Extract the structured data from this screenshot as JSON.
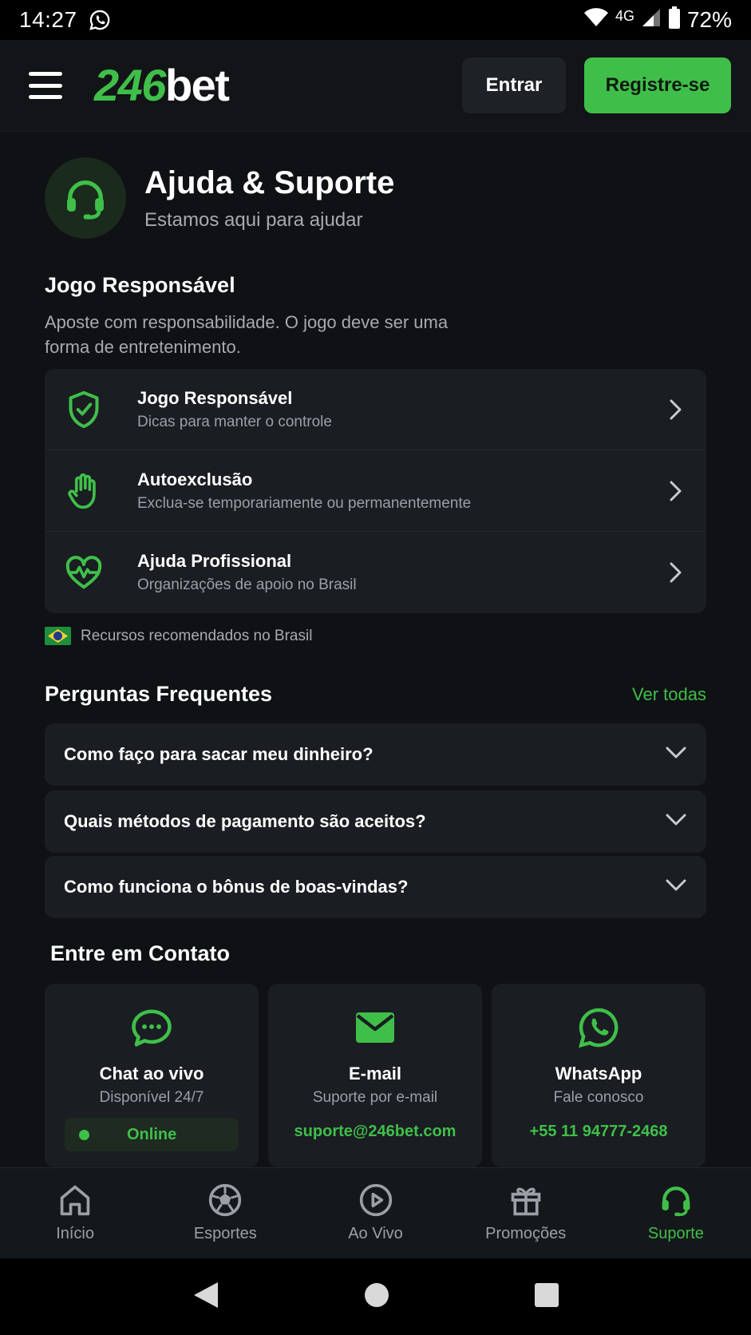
{
  "status_bar": {
    "time": "14:27",
    "network": "4G",
    "battery": "72%"
  },
  "header": {
    "logo_number": "246",
    "logo_text": "bet",
    "login_label": "Entrar",
    "register_label": "Registre-se"
  },
  "hero": {
    "title": "Ajuda & Suporte",
    "subtitle": "Estamos aqui para ajudar"
  },
  "responsible": {
    "title": "Jogo Responsável",
    "description": "Aposte com responsabilidade. O jogo deve ser uma forma de entretenimento.",
    "items": [
      {
        "title": "Jogo Responsável",
        "subtitle": "Dicas para manter o controle",
        "icon": "shield-check-icon"
      },
      {
        "title": "Autoexclusão",
        "subtitle": "Exclua-se temporariamente ou permanentemente",
        "icon": "hand-stop-icon"
      },
      {
        "title": "Ajuda Profissional",
        "subtitle": "Organizações de apoio no Brasil",
        "icon": "heart-pulse-icon"
      }
    ],
    "flag_note": "Recursos recomendados no Brasil"
  },
  "faq": {
    "title": "Perguntas Frequentes",
    "see_all": "Ver todas",
    "items": [
      "Como faço para sacar meu dinheiro?",
      "Quais métodos de pagamento são aceitos?",
      "Como funciona o bônus de boas-vindas?"
    ]
  },
  "contact": {
    "title": "Entre em Contato",
    "chat": {
      "name": "Chat ao vivo",
      "subtitle": "Disponível 24/7",
      "status": "Online"
    },
    "email": {
      "name": "E-mail",
      "subtitle": "Suporte por e-mail",
      "address": "suporte@246bet.com"
    },
    "whatsapp": {
      "name": "WhatsApp",
      "subtitle": "Fale conosco",
      "phone": "+55 11 94777-2468"
    }
  },
  "bottom_nav": {
    "items": [
      "Início",
      "Esportes",
      "Ao Vivo",
      "Promoções",
      "Suporte"
    ],
    "active": "Suporte"
  },
  "colors": {
    "accent": "#3fbf4a",
    "background": "#0f1114",
    "card": "#1a1d21"
  }
}
